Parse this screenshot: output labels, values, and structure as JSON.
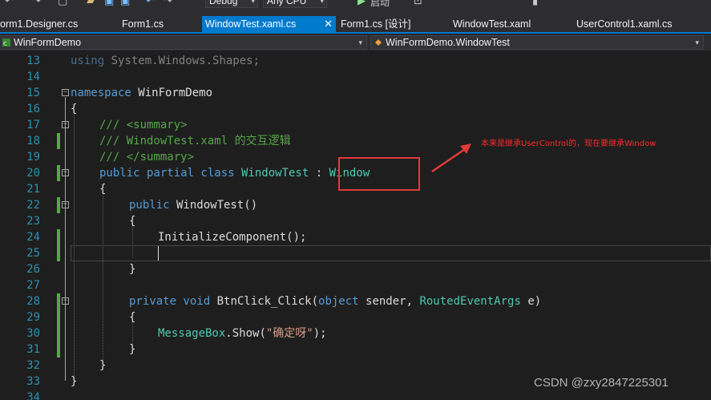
{
  "toolbar": {
    "config": "Debug",
    "platform": "Any CPU",
    "start_label": "启动"
  },
  "tabs": [
    {
      "label": "orm1.Designer.cs"
    },
    {
      "label": "Form1.cs"
    },
    {
      "label": "WindowTest.xaml.cs",
      "close": "✕"
    },
    {
      "label": "Form1.cs [设计]"
    },
    {
      "label": "WindowTest.xaml"
    },
    {
      "label": "UserControl1.xaml.cs"
    }
  ],
  "nav": {
    "project": "WinFormDemo",
    "class": "WinFormDemo.WindowTest"
  },
  "line_numbers": [
    "13",
    "14",
    "15",
    "16",
    "17",
    "18",
    "19",
    "20",
    "21",
    "22",
    "23",
    "24",
    "25",
    "26",
    "27",
    "28",
    "29",
    "30",
    "31",
    "32",
    "33",
    "34"
  ],
  "code": {
    "l13_kw": "using",
    "l13_rest": " System.Windows.Shapes;",
    "l15_kw": "namespace",
    "l15_rest": " WinFormDemo",
    "l16": "{",
    "l17": "/// <summary>",
    "l18": "/// WindowTest.xaml 的交互逻辑",
    "l19": "/// </summary>",
    "l20_kw": "public partial class",
    "l20_name": " WindowTest",
    "l20_colon": " : ",
    "l20_base": "Window",
    "l21": "{",
    "l22_kw": "public",
    "l22_rest": " WindowTest()",
    "l23": "{",
    "l24": "InitializeComponent();",
    "l26": "}",
    "l28_kw": "private void",
    "l28_method": " BtnClick_Click(",
    "l28_t1": "object",
    "l28_p1": " sender, ",
    "l28_t2": "RoutedEventArgs",
    "l28_p2": " e)",
    "l29": "{",
    "l30_type": "MessageBox",
    "l30_call": ".Show(",
    "l30_str": "\"确定呀\"",
    "l30_end": ");",
    "l31": "}",
    "l32": "}",
    "l33": "}"
  },
  "annotation": "本来是继承UserControl的，现在要继承Window",
  "watermark": "CSDN @zxy2847225301",
  "colors": {
    "accent": "#007acc",
    "annotation": "#e23a3a",
    "keyword": "#569cd6",
    "type": "#4ec9b0",
    "comment": "#57a64a"
  }
}
